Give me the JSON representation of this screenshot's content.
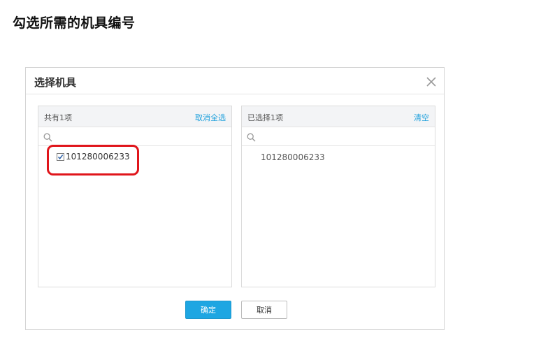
{
  "page": {
    "title": "勾选所需的机具编号"
  },
  "dialog": {
    "title": "选择机具",
    "close_icon": "close-icon",
    "left_panel": {
      "count_text": "共有1项",
      "action_label": "取消全选",
      "search_placeholder": "",
      "items": [
        {
          "label": "101280006233",
          "checked": true
        }
      ]
    },
    "right_panel": {
      "count_text": "已选择1项",
      "action_label": "清空",
      "search_placeholder": "",
      "items": [
        {
          "label": "101280006233"
        }
      ]
    },
    "buttons": {
      "ok_label": "确定",
      "cancel_label": "取消"
    }
  },
  "colors": {
    "accent": "#1ea6e2",
    "link": "#1ea0dc",
    "highlight": "#e0151b"
  }
}
